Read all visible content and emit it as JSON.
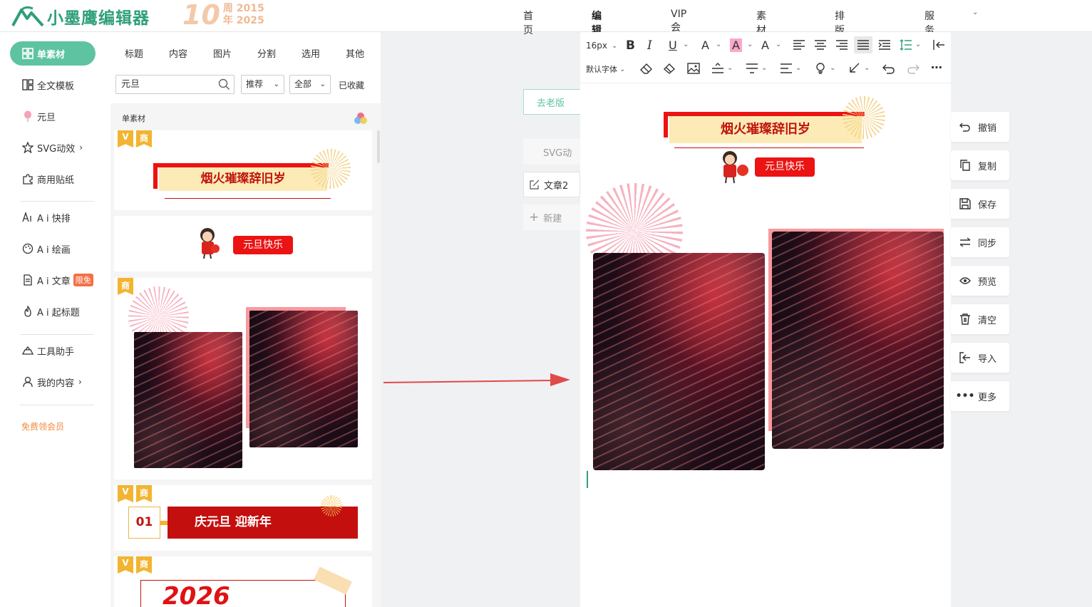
{
  "brand": {
    "name": "小墨鹰编辑器",
    "anniv_num": "10",
    "anniv_line1": "周 2015",
    "anniv_line2": "年 2025"
  },
  "nav": [
    "首页",
    "编辑器",
    "VIP会员",
    "素材库",
    "排版课堂",
    "服务中心"
  ],
  "sidebar": {
    "items": [
      "单素材",
      "全文模板",
      "元旦",
      "SVG动效",
      "商用贴纸",
      "A i 快排",
      "A i 绘画",
      "A i 文章",
      "A i 起标题",
      "工具助手",
      "我的内容"
    ],
    "badge_ai_article": "限免",
    "free_member": "免费领会员"
  },
  "materials": {
    "tabs": [
      "标题",
      "内容",
      "图片",
      "分割",
      "选用",
      "其他"
    ],
    "search_value": "元旦",
    "sort_select": "推荐",
    "scope_select": "全部",
    "collected": "已收藏",
    "section_title": "单素材",
    "tag_v": "V",
    "tag_shang": "商",
    "card1_banner": "烟火璀璨辞旧岁",
    "card2_badge": "元旦快乐",
    "card4_num": "01",
    "card4_title": "庆元旦 迎新年",
    "card5_text": "2026"
  },
  "left_buttons": {
    "old_version": "去老版",
    "svg_anim": "SVG动",
    "article": "文章2",
    "new": "新建"
  },
  "toolbar": {
    "font_size": "16px",
    "font_family": "默认字体"
  },
  "editor": {
    "banner": "烟火璀璨辞旧岁",
    "badge": "元旦快乐"
  },
  "actions": [
    "撤销",
    "复制",
    "保存",
    "同步",
    "预览",
    "清空",
    "导入",
    "更多"
  ],
  "colors": {
    "accent": "#5ec3a0",
    "brand_green": "#2f9f78",
    "banner_red": "#ec1313"
  }
}
